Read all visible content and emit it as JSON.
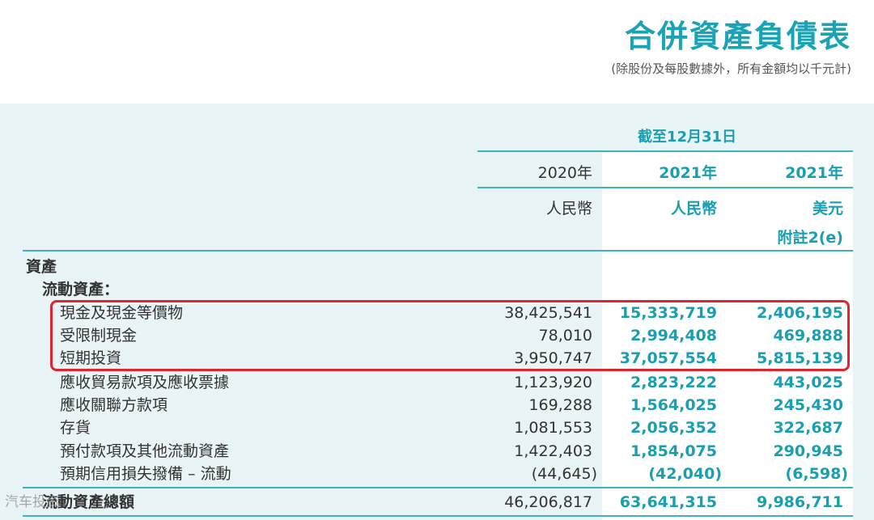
{
  "title": "合併資產負債表",
  "subtitle": "(除股份及每股數據外，所有金額均以千元計)",
  "period_header": "截至12月31日",
  "columns": [
    {
      "year": "2020年",
      "currency": "人民幣",
      "note": ""
    },
    {
      "year": "2021年",
      "currency": "人民幣",
      "note": ""
    },
    {
      "year": "2021年",
      "currency": "美元",
      "note": "附註2(e)"
    }
  ],
  "section_label": "資產",
  "subsection_label": "流動資產：",
  "rows": [
    {
      "label": "現金及現金等價物",
      "v2020": "38,425,541",
      "v2021": "15,333,719",
      "usd": "2,406,195"
    },
    {
      "label": "受限制現金",
      "v2020": "78,010",
      "v2021": "2,994,408",
      "usd": "469,888"
    },
    {
      "label": "短期投資",
      "v2020": "3,950,747",
      "v2021": "37,057,554",
      "usd": "5,815,139"
    },
    {
      "label": "應收貿易款項及應收票據",
      "v2020": "1,123,920",
      "v2021": "2,823,222",
      "usd": "443,025"
    },
    {
      "label": "應收關聯方款項",
      "v2020": "169,288",
      "v2021": "1,564,025",
      "usd": "245,430"
    },
    {
      "label": "存貨",
      "v2020": "1,081,553",
      "v2021": "2,056,352",
      "usd": "322,687"
    },
    {
      "label": "預付款項及其他流動資產",
      "v2020": "1,422,403",
      "v2021": "1,854,075",
      "usd": "290,945"
    },
    {
      "label": "預期信用損失撥備 – 流動",
      "v2020": "(44,645)",
      "v2021": "(42,040)",
      "usd": "(6,598)"
    }
  ],
  "total": {
    "label": "流動資產總額",
    "v2020": "46,206,817",
    "v2021": "63,641,315",
    "usd": "9,986,711"
  },
  "watermark": "汽车投资",
  "colors": {
    "accent": "#1a9fb0",
    "highlight_border": "#e0252c",
    "panel_bg": "#e8f4f6"
  }
}
